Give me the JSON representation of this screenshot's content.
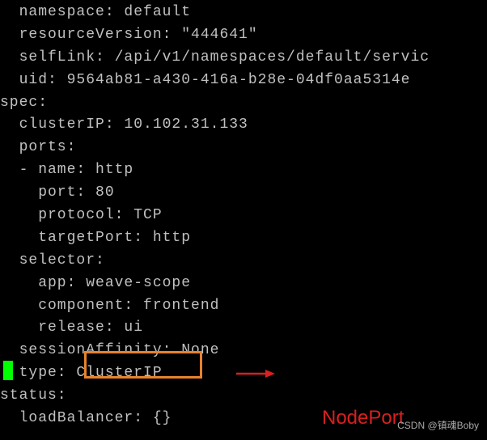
{
  "lines": {
    "l0": "  namespace: default",
    "l1": "  resourceVersion: \"444641\"",
    "l2": "  selfLink: /api/v1/namespaces/default/servic",
    "l3": "  uid: 9564ab81-a430-416a-b28e-04df0aa5314e",
    "l4": "spec:",
    "l5": "  clusterIP: 10.102.31.133",
    "l6": "  ports:",
    "l7": "  - name: http",
    "l8": "    port: 80",
    "l9": "    protocol: TCP",
    "l10": "    targetPort: http",
    "l11": "  selector:",
    "l12": "    app: weave-scope",
    "l13": "    component: frontend",
    "l14": "    release: ui",
    "l15": "  sessionAffinity: None",
    "l16": "  type: ClusterIP",
    "l17": "status:",
    "l18": "  loadBalancer: {}"
  },
  "annotation": {
    "highlighted_value": "ClusterIP",
    "replacement_label": "NodePort"
  },
  "watermark": "CSDN @镇魂Boby"
}
